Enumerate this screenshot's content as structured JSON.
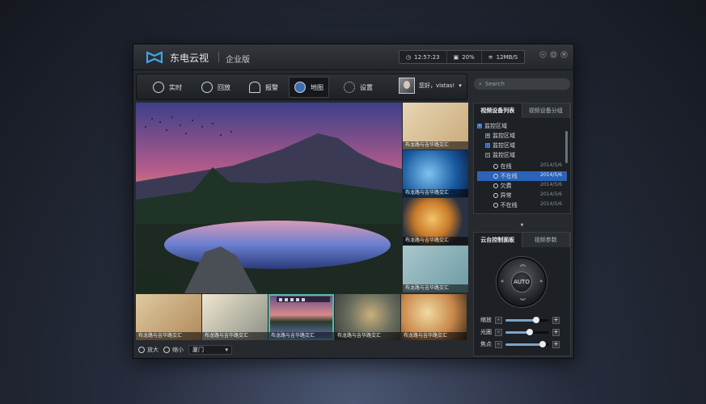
{
  "app": {
    "brand": "东电云视",
    "edition": "企业版"
  },
  "stats": {
    "time": "12:57:23",
    "cpu": "20%",
    "network": "12MB/S"
  },
  "toolbar": {
    "items": [
      {
        "label": "实时",
        "icon": "clock-icon"
      },
      {
        "label": "回放",
        "icon": "play-icon"
      },
      {
        "label": "报警",
        "icon": "alarm-icon"
      },
      {
        "label": "地图",
        "icon": "globe-icon",
        "active": true
      },
      {
        "label": "设置",
        "icon": "gear-icon"
      }
    ],
    "user_greeting": "您好，vistas!"
  },
  "search": {
    "placeholder": "Search"
  },
  "video": {
    "caption": "布龙路与吉华路交汇",
    "side_thumbs": [
      "布龙路与吉华路交汇",
      "布龙路与吉华路交汇",
      "布龙路与吉华路交汇",
      "布龙路与吉华路交汇"
    ],
    "bottom_thumbs": [
      "布龙路与吉华路交汇",
      "布龙路与吉华路交汇",
      "布龙路与吉华路交汇",
      "布龙路与吉华路交汇",
      "布龙路与吉华路交汇"
    ]
  },
  "bottombar": {
    "zoom_in": "放大",
    "zoom_out": "缩小",
    "select_value": "厦门"
  },
  "device_panel": {
    "tabs": [
      "视频设备列表",
      "视频设备分组"
    ],
    "root": "监控区域",
    "groups": [
      "监控区域",
      "监控区域",
      "监控区域"
    ],
    "devices": [
      {
        "name": "在线",
        "date": "2014/5/6"
      },
      {
        "name": "不在线",
        "date": "2014/5/6",
        "selected": true
      },
      {
        "name": "欠费",
        "date": "2014/5/6"
      },
      {
        "name": "异常",
        "date": "2014/5/6"
      },
      {
        "name": "不在线",
        "date": "2014/5/6"
      }
    ]
  },
  "ptz_panel": {
    "tabs": [
      "云台控制面板",
      "视频参数"
    ],
    "center_label": "AUTO",
    "sliders": [
      {
        "label": "缩放",
        "value": 0.7
      },
      {
        "label": "光圈",
        "value": 0.55
      },
      {
        "label": "焦点",
        "value": 0.85
      }
    ]
  },
  "colors": {
    "accent_selection": "#2c63b9",
    "thumb_highlight": "#4ec0a4"
  }
}
